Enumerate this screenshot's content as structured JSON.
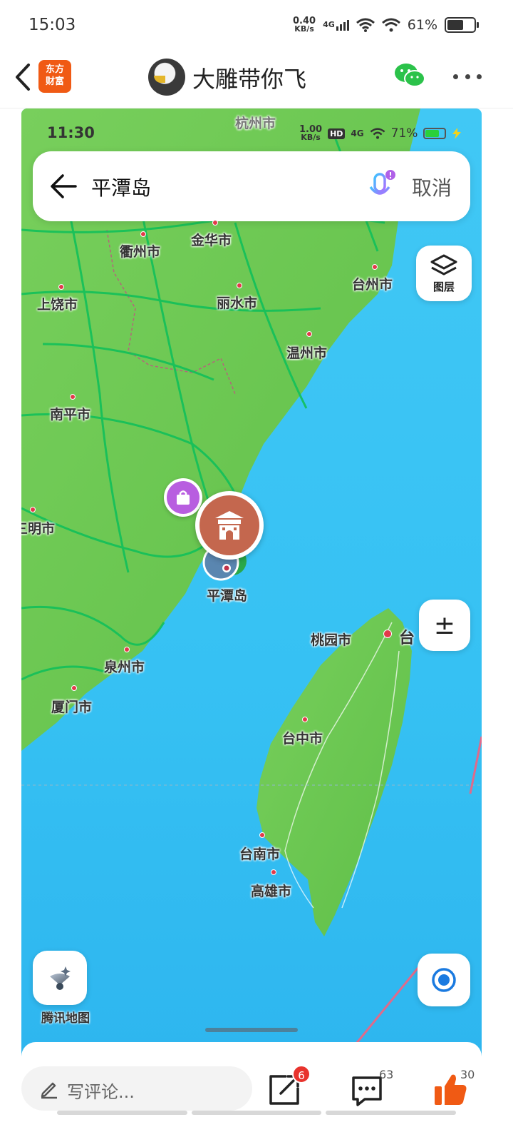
{
  "status_bar": {
    "time": "15:03",
    "net_speed_value": "0.40",
    "net_speed_unit": "KB/s",
    "network": "4G",
    "battery": "61%",
    "battery_level": 0.61
  },
  "header": {
    "logo_line1": "东方",
    "logo_line2": "财富",
    "author_name": "大雕带你飞",
    "logo_color": "#f05a14"
  },
  "screenshot": {
    "status": {
      "time": "11:30",
      "net_speed_value": "1.00",
      "net_speed_unit": "KB/s",
      "hd": "HD",
      "network": "4G",
      "battery": "71%"
    },
    "search": {
      "query": "平潭岛",
      "cancel_label": "取消"
    },
    "layers_label": "图层",
    "zoom_label": "±",
    "tencent_maps_label": "腾讯地图",
    "cities": {
      "hangzhou": "杭州市",
      "quzhou": "衢州市",
      "jinhua": "金华市",
      "taizhou": "台州市",
      "shangrao": "上饶市",
      "lishui": "丽水市",
      "wenzhou": "温州市",
      "nanping": "南平市",
      "sanming": "三明市",
      "pingtan": "平潭岛",
      "taoyuan": "桃园市",
      "tai": "台",
      "quanzhou": "泉州市",
      "xiamen": "厦门市",
      "taichung": "台中市",
      "tainan": "台南市",
      "kaohsiung": "高雄市"
    },
    "colors": {
      "sea": "#36c1f3",
      "land": "#6cc94f",
      "road": "#12c05a",
      "poi_marker": "#c4674e",
      "shop_marker": "#b85ee0"
    }
  },
  "bottom_bar": {
    "comment_placeholder": "写评论...",
    "share_badge": "6",
    "comments_count": "63",
    "likes_count": "30",
    "like_color": "#f05a14"
  }
}
